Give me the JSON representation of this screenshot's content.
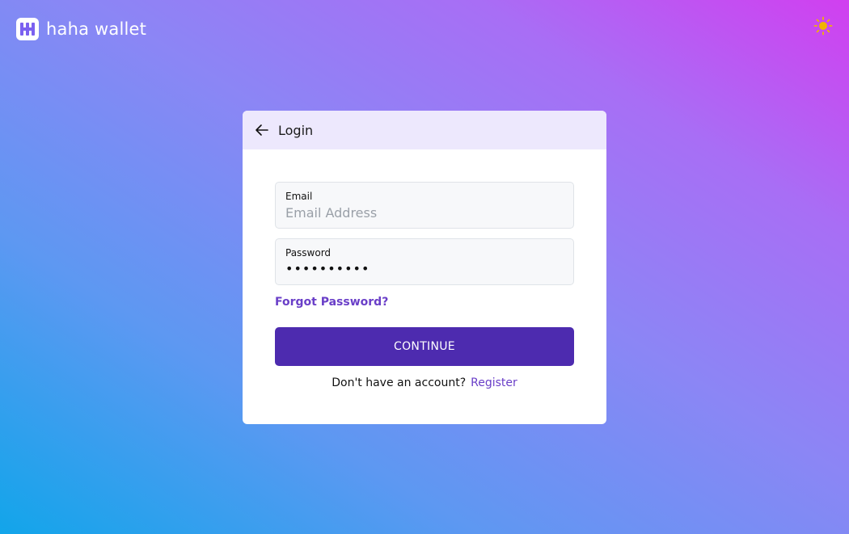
{
  "brand": {
    "name": "haha wallet",
    "logo_icon": "haha-logo-icon"
  },
  "theme_toggle": {
    "icon": "sun-icon",
    "color": "#f0b400"
  },
  "card": {
    "title": "Login",
    "back_icon": "arrow-left-icon",
    "email": {
      "label": "Email",
      "value": "",
      "placeholder": "Email Address"
    },
    "password": {
      "label": "Password",
      "masked_value": "••••••••••"
    },
    "forgot_label": "Forgot Password?",
    "continue_label": "CONTINUE",
    "register_prompt": "Don't have an account?",
    "register_label": "Register"
  },
  "colors": {
    "primary": "#4d2baf",
    "link": "#6a3fc8",
    "header_bg": "#ede8fd",
    "gradient_top_right": "#d13ff0",
    "gradient_bottom_left": "#12a5ea"
  }
}
